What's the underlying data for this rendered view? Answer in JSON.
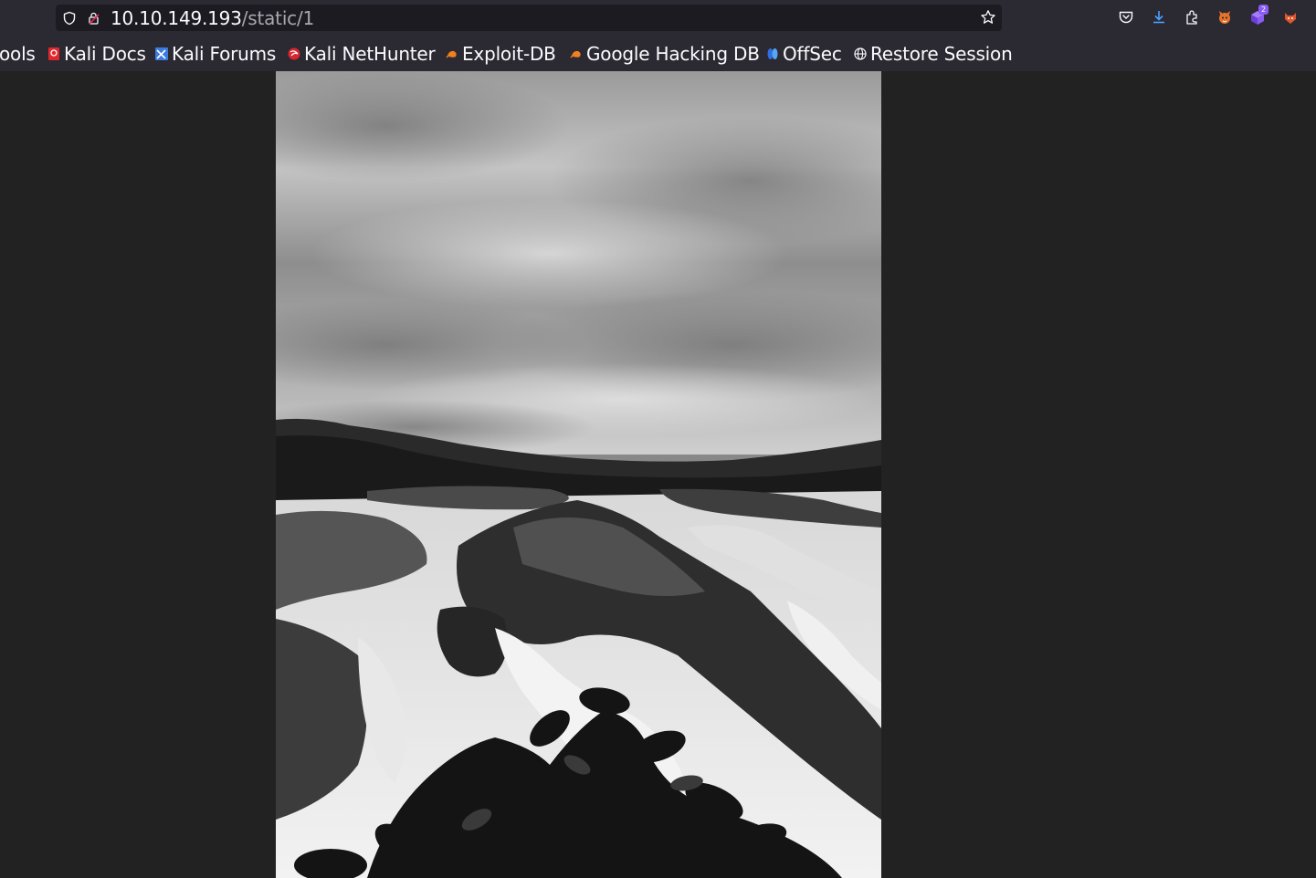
{
  "browser": {
    "url_host": "10.10.149.193",
    "url_path": "/static/1",
    "toolbar_icons": [
      "shield-icon",
      "lock-warning-icon",
      "bookmark-star-icon",
      "pocket-icon",
      "download-icon",
      "extensions-icon",
      "extension-fox-icon",
      "extension-cube-icon",
      "extension-foxyproxy-icon"
    ],
    "extension_badge": "2",
    "accent_download": "#4aa3ff"
  },
  "bookmarks": [
    {
      "label": "ools",
      "icon": ""
    },
    {
      "label": "Kali Docs",
      "icon": "kali-docs-icon"
    },
    {
      "label": "Kali Forums",
      "icon": "kali-forums-icon"
    },
    {
      "label": "Kali NetHunter",
      "icon": "kali-nethunter-icon"
    },
    {
      "label": "Exploit-DB",
      "icon": "exploit-db-icon"
    },
    {
      "label": "Google Hacking DB",
      "icon": "exploit-db-icon"
    },
    {
      "label": "OffSec",
      "icon": "offsec-icon"
    },
    {
      "label": "Restore Session",
      "icon": "globe-icon"
    }
  ],
  "page": {
    "background": "#222222",
    "image_subject": "black-and-white river rapids photo"
  }
}
